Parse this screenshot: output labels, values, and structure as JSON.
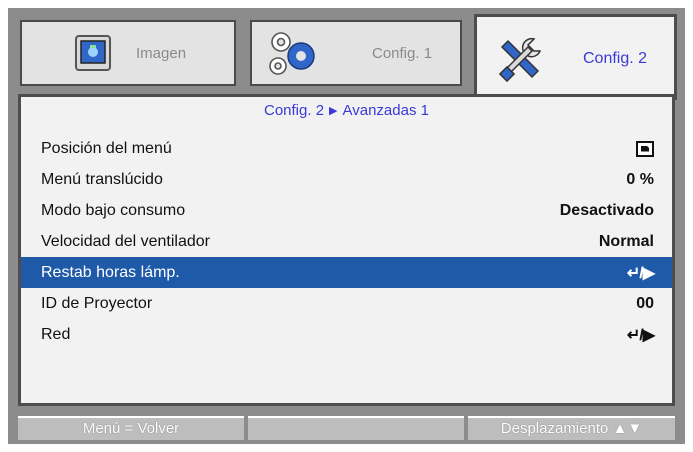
{
  "tabs": [
    {
      "label": "Imagen",
      "icon": "image-settings-icon"
    },
    {
      "label": "Config. 1",
      "icon": "gears-icon"
    },
    {
      "label": "Config. 2",
      "icon": "tools-icon"
    }
  ],
  "breadcrumb": {
    "parent": "Config. 2",
    "separator": "▶",
    "current": "Avanzadas 1"
  },
  "menu_items": [
    {
      "label": "Posición del menú",
      "value": ""
    },
    {
      "label": "Menú translúcido",
      "value": "0 %"
    },
    {
      "label": "Modo bajo consumo",
      "value": "Desactivado"
    },
    {
      "label": "Velocidad del ventilador",
      "value": "Normal"
    },
    {
      "label": "Restab horas lámp.",
      "value": "↵/▶"
    },
    {
      "label": "ID de Proyector",
      "value": "00"
    },
    {
      "label": "Red",
      "value": "↵/▶"
    }
  ],
  "footer": {
    "left": "Menú = Volver",
    "middle": "",
    "right": "Desplazamiento ▲▼"
  },
  "colors": {
    "accent": "#3a3ad8",
    "selected": "#1f5aa8",
    "frame": "#8c8c8c"
  }
}
